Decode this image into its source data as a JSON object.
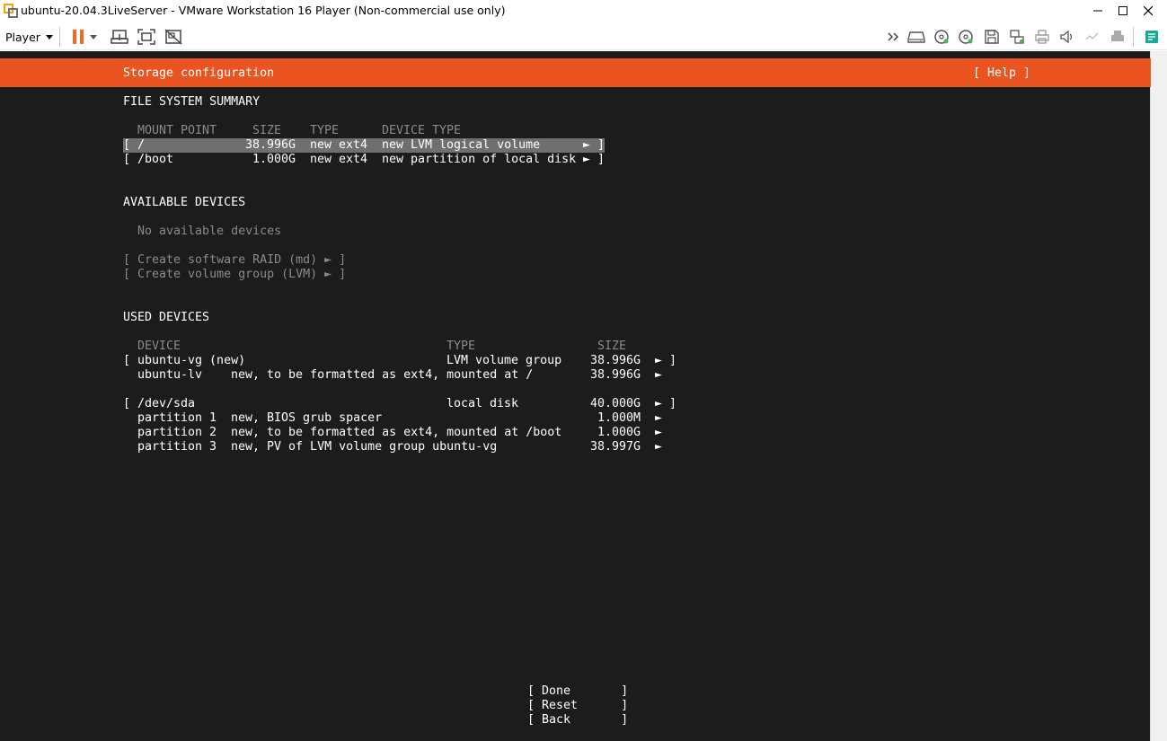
{
  "window": {
    "title": "ubuntu-20.04.3LiveServer - VMware Workstation 16 Player (Non-commercial use only)",
    "app_icon": "vmware-icon"
  },
  "toolbar": {
    "player_label": "Player",
    "icons": [
      "pause-icon",
      "dropdown-icon",
      "send-ctrl-alt-del-icon",
      "full-screen-icon",
      "unity-icon",
      "more-devices-icon",
      "hard-disk-icon",
      "cd-dvd-icon",
      "cd-dvd-2-icon",
      "floppy-icon",
      "network-icon",
      "printer-icon",
      "sound-icon",
      "usb-icon",
      "printer-2-icon",
      "message-log-icon"
    ]
  },
  "installer": {
    "header_title": "Storage configuration",
    "help_label": "[ Help ]",
    "accent": "#e95420",
    "fs_summary": {
      "heading": "FILE SYSTEM SUMMARY",
      "col_mount": "MOUNT POINT",
      "col_size": "SIZE",
      "col_type": "TYPE",
      "col_device_type": "DEVICE TYPE",
      "rows": [
        {
          "open": "[",
          "mount": "/",
          "size": "38.996G",
          "type": "new ext4",
          "device_type": "new LVM logical volume",
          "arrow": "►",
          "close": "]"
        },
        {
          "open": "[",
          "mount": "/boot",
          "size": "1.000G",
          "type": "new ext4",
          "device_type": "new partition of local disk",
          "arrow": "►",
          "close": "]"
        }
      ]
    },
    "available": {
      "heading": "AVAILABLE DEVICES",
      "empty_text": "No available devices",
      "create_raid": "[ Create software RAID (md) ► ]",
      "create_vg": "[ Create volume group (LVM) ► ]"
    },
    "used": {
      "heading": "USED DEVICES",
      "col_device": "DEVICE",
      "col_type": "TYPE",
      "col_size": "SIZE",
      "lines": [
        {
          "open": "[",
          "device": "ubuntu-vg (new)",
          "type": "LVM volume group",
          "size": "38.996G",
          "arrow": "►",
          "close": "]"
        },
        {
          "device": "ubuntu-lv",
          "desc": "new, to be formatted as ext4, mounted at /",
          "size": "38.996G",
          "arrow": "►"
        },
        {
          "open": "[",
          "device": "/dev/sda",
          "type": "local disk",
          "size": "40.000G",
          "arrow": "►",
          "close": "]"
        },
        {
          "device": "partition 1",
          "desc": "new, BIOS grub spacer",
          "size": "1.000M",
          "arrow": "►"
        },
        {
          "device": "partition 2",
          "desc": "new, to be formatted as ext4, mounted at /boot",
          "size": "1.000G",
          "arrow": "►"
        },
        {
          "device": "partition 3",
          "desc": "new, PV of LVM volume group ubuntu-vg",
          "size": "38.997G",
          "arrow": "►"
        }
      ]
    },
    "buttons": {
      "done": "[ Done       ]",
      "reset": "[ Reset      ]",
      "back": "[ Back       ]"
    }
  }
}
